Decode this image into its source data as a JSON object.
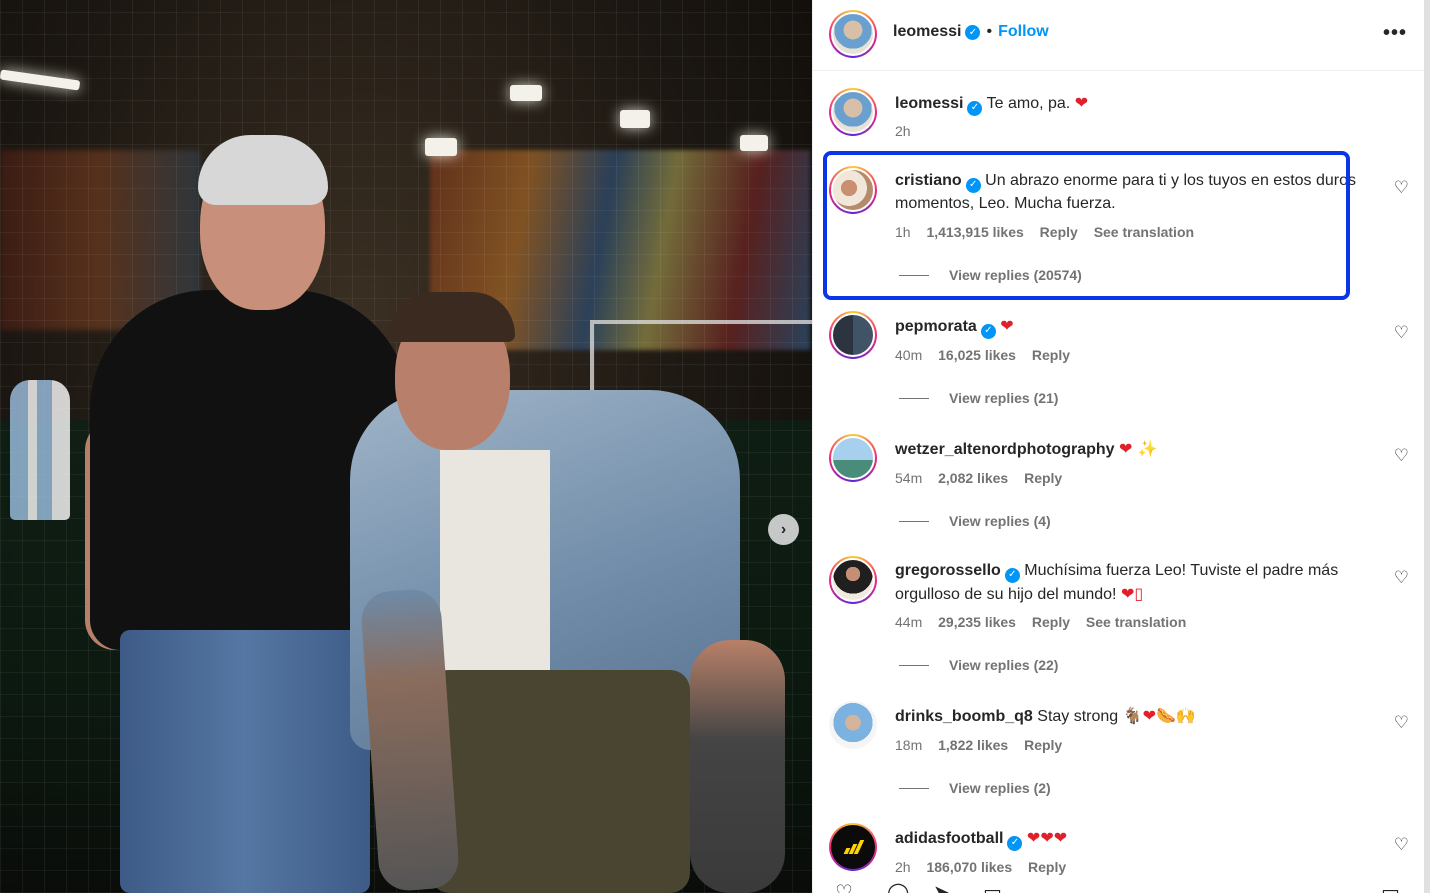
{
  "post": {
    "author": "leomessi",
    "follow_label": "Follow",
    "separator": "•",
    "more_label": "•••",
    "carousel_next": "›"
  },
  "caption": {
    "username": "leomessi",
    "text": "Te amo, pa.",
    "emoji": "❤",
    "time": "2h"
  },
  "comments": [
    {
      "username": "cristiano",
      "verified": true,
      "text": "Un abrazo enorme para ti y los tuyos en estos duros momentos, Leo. Mucha fuerza.",
      "time": "1h",
      "likes": "1,413,915 likes",
      "reply": "Reply",
      "translate": "See translation",
      "view_replies": "View replies (20574)"
    },
    {
      "username": "pepmorata",
      "verified": true,
      "text": "",
      "emoji": "❤",
      "time": "40m",
      "likes": "16,025 likes",
      "reply": "Reply",
      "view_replies": "View replies (21)"
    },
    {
      "username": "wetzer_altenordphotography",
      "verified": false,
      "text": "",
      "emoji": "❤ ✨",
      "time": "54m",
      "likes": "2,082 likes",
      "reply": "Reply",
      "view_replies": "View replies (4)"
    },
    {
      "username": "gregorossello",
      "verified": true,
      "text": "Muchísima fuerza Leo! Tuviste el padre más orgulloso de su hijo del mundo!",
      "emoji": "❤▯",
      "time": "44m",
      "likes": "29,235 likes",
      "reply": "Reply",
      "translate": "See translation",
      "view_replies": "View replies (22)"
    },
    {
      "username": "drinks_boomb_q8",
      "verified": false,
      "text": "Stay strong",
      "emoji": "🐐❤🌭🙌",
      "time": "18m",
      "likes": "1,822 likes",
      "reply": "Reply",
      "view_replies": "View replies (2)"
    },
    {
      "username": "adidasfootball",
      "verified": true,
      "text": "",
      "emoji": "❤❤❤",
      "time": "2h",
      "likes": "186,070 likes",
      "reply": "Reply"
    }
  ],
  "icons": {
    "verified": "✓",
    "heart_outline": "♡"
  },
  "colors": {
    "accent": "#0095f6",
    "highlight": "#0a35e8",
    "heart": "#e0212b"
  }
}
